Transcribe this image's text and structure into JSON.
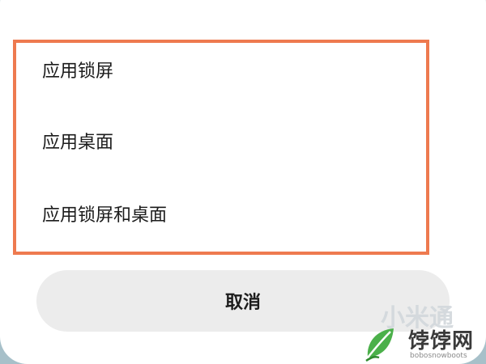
{
  "dialog": {
    "options": [
      {
        "label": "应用锁屏"
      },
      {
        "label": "应用桌面"
      },
      {
        "label": "应用锁屏和桌面"
      }
    ],
    "cancel_label": "取消"
  },
  "watermark": {
    "text_faded": "小米通",
    "site_name": "饽饽网",
    "domain": "bobosnowboots"
  },
  "colors": {
    "highlight_border": "#ee7a4f",
    "cancel_bg": "#ececec",
    "background": "#a7c0c9"
  }
}
